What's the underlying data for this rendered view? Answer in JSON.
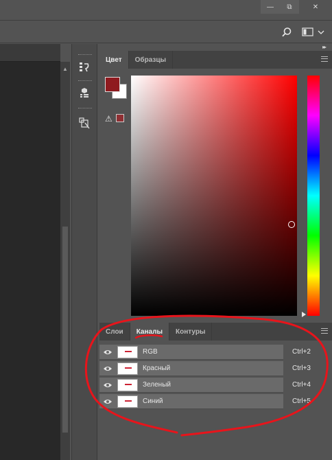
{
  "window": {
    "minimize_glyph": "—",
    "maximize_glyph": "⧉",
    "close_glyph": "✕"
  },
  "dock": {
    "collapse_glyph": "◂◂",
    "expand_glyph": "▸▸",
    "tools": [
      {
        "icon": "history-icon"
      },
      {
        "icon": "3d-cube-icon"
      },
      {
        "icon": "path-select-icon"
      }
    ]
  },
  "color_panel": {
    "tabs": [
      {
        "label": "Цвет",
        "active": true
      },
      {
        "label": "Образцы",
        "active": false
      }
    ],
    "foreground_color": "#8f1a1f",
    "background_color": "#ffffff",
    "gamut_warning_glyph": "⚠"
  },
  "channels_panel": {
    "tabs": [
      {
        "label": "Слои",
        "active": false
      },
      {
        "label": "Каналы",
        "active": true
      },
      {
        "label": "Контуры",
        "active": false
      }
    ],
    "channels": [
      {
        "name": "RGB",
        "shortcut": "Ctrl+2"
      },
      {
        "name": "Красный",
        "shortcut": "Ctrl+3"
      },
      {
        "name": "Зеленый",
        "shortcut": "Ctrl+4"
      },
      {
        "name": "Синий",
        "shortcut": "Ctrl+5"
      }
    ]
  },
  "annotation": {
    "color": "#e8141b"
  }
}
